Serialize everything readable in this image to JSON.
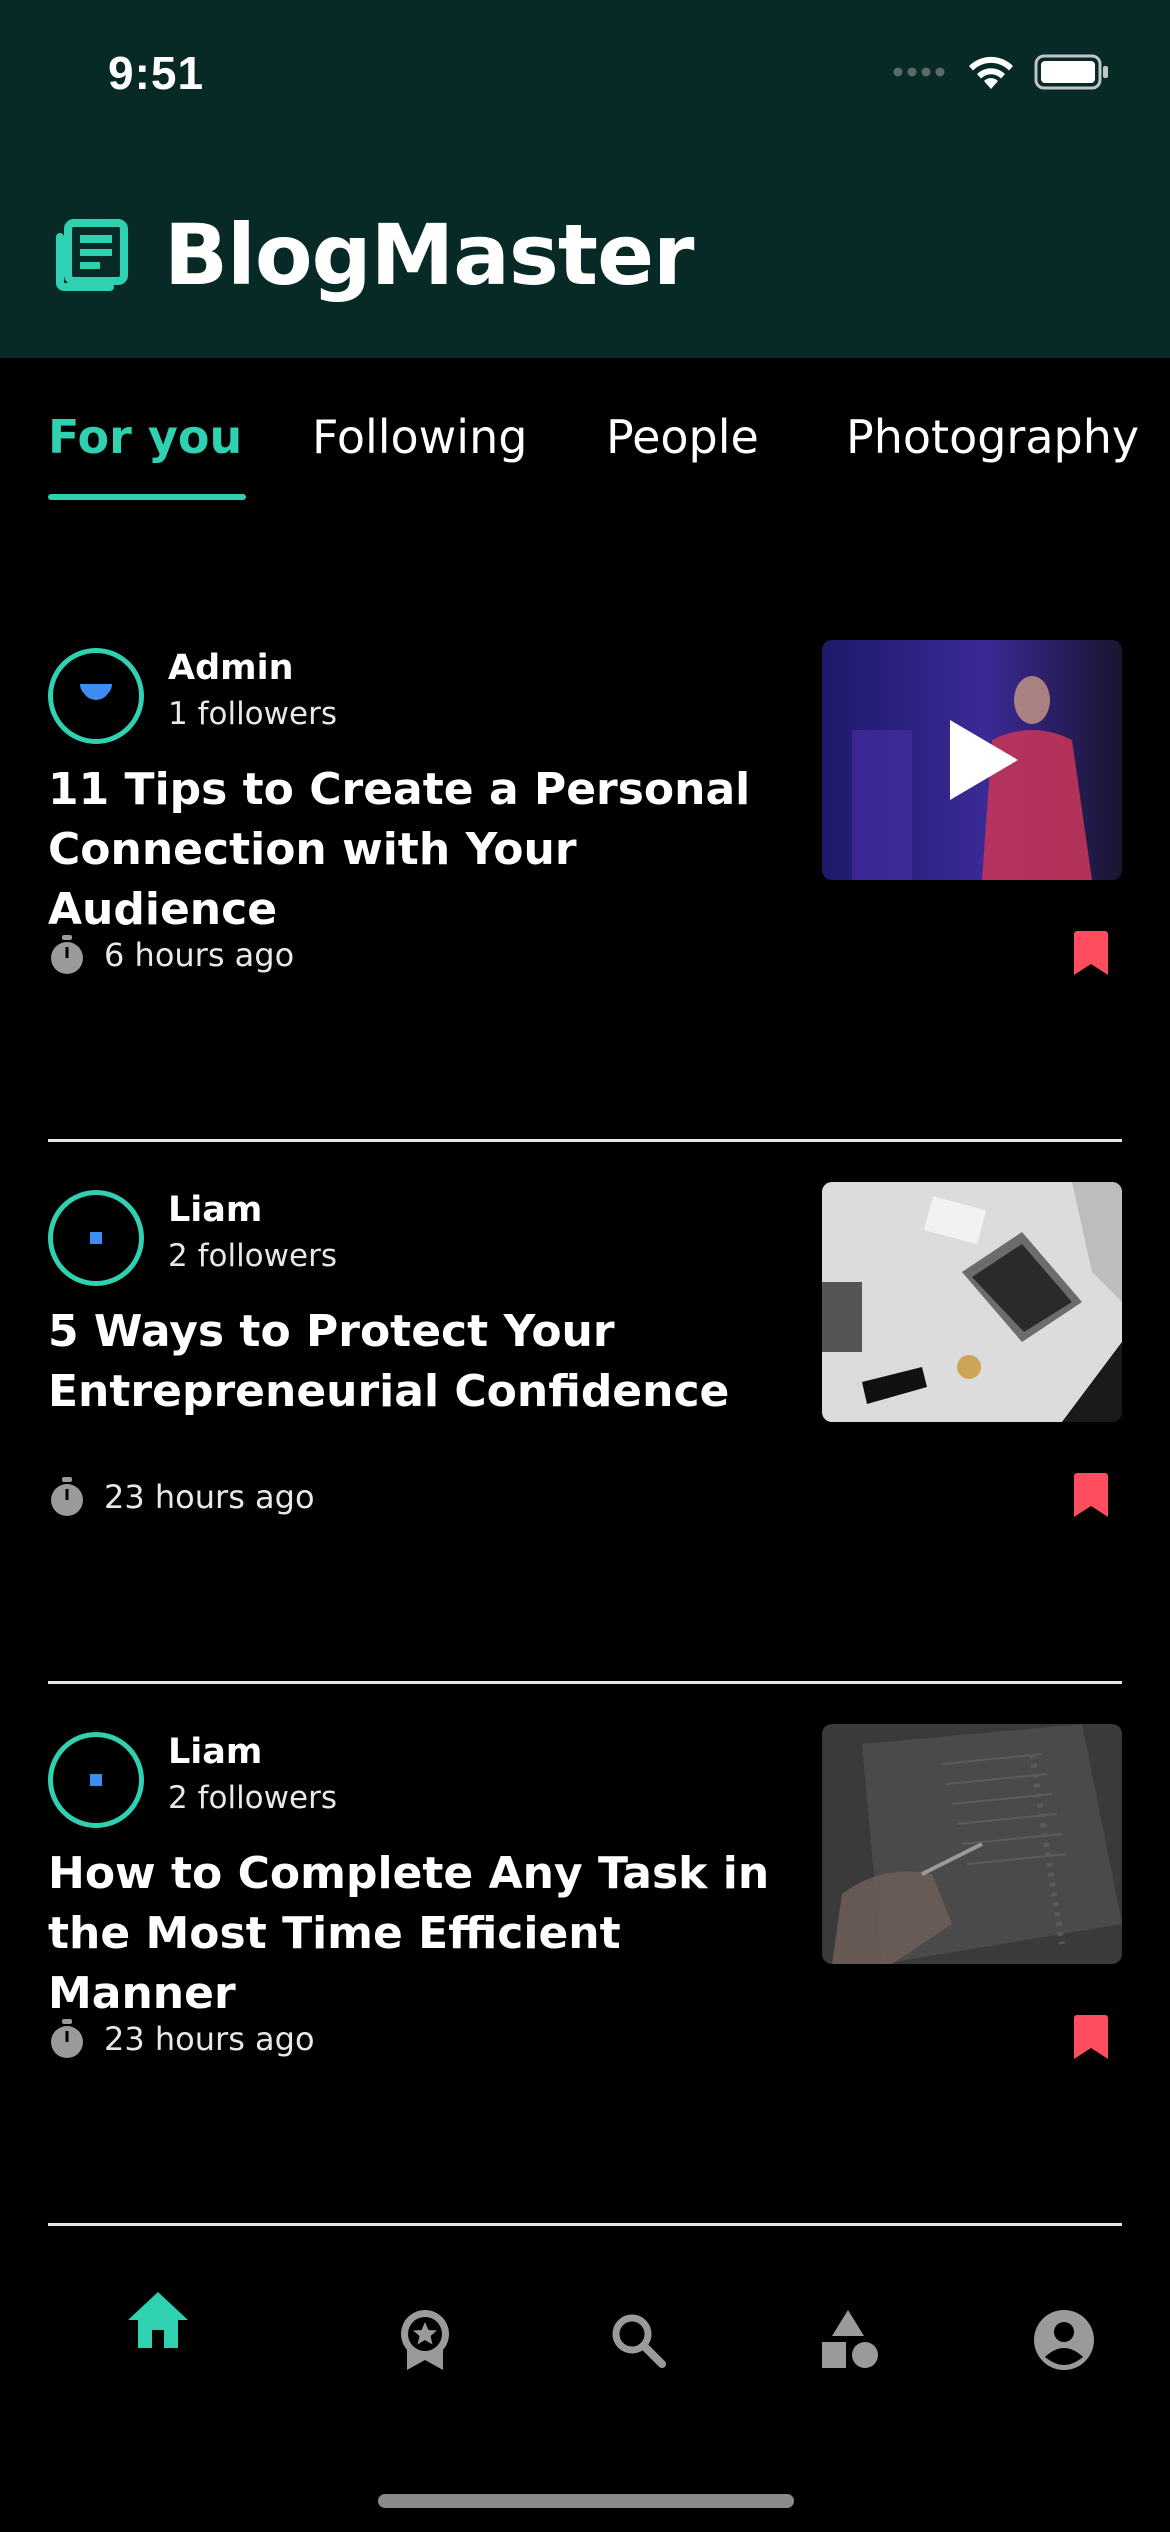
{
  "status_bar": {
    "time": "9:51"
  },
  "app": {
    "title": "BlogMaster"
  },
  "tabs": [
    {
      "label": "For you",
      "active": true
    },
    {
      "label": "Following",
      "active": false
    },
    {
      "label": "People",
      "active": false
    },
    {
      "label": "Photography",
      "active": false
    }
  ],
  "posts": [
    {
      "author": "Admin",
      "followers": "1 followers",
      "title": "11 Tips to Create a Personal Connection with Your Audience",
      "time": "6 hours ago",
      "has_video": true
    },
    {
      "author": "Liam",
      "followers": "2 followers",
      "title": "5 Ways to Protect Your Entrepreneurial Confidence",
      "time": "23 hours ago",
      "has_video": false
    },
    {
      "author": "Liam",
      "followers": "2 followers",
      "title": "How to Complete Any Task in the Most Time Efficient Manner",
      "time": "23 hours ago",
      "has_video": false
    }
  ],
  "bottom_nav": [
    {
      "icon": "home-icon",
      "active": true
    },
    {
      "icon": "award-icon",
      "active": false
    },
    {
      "icon": "search-icon",
      "active": false
    },
    {
      "icon": "categories-icon",
      "active": false
    },
    {
      "icon": "profile-icon",
      "active": false
    }
  ],
  "colors": {
    "header_bg": "#072a26",
    "accent": "#2fd1b0",
    "bookmark": "#ff4d5e",
    "avatar_dot": "#3d8ef0"
  }
}
